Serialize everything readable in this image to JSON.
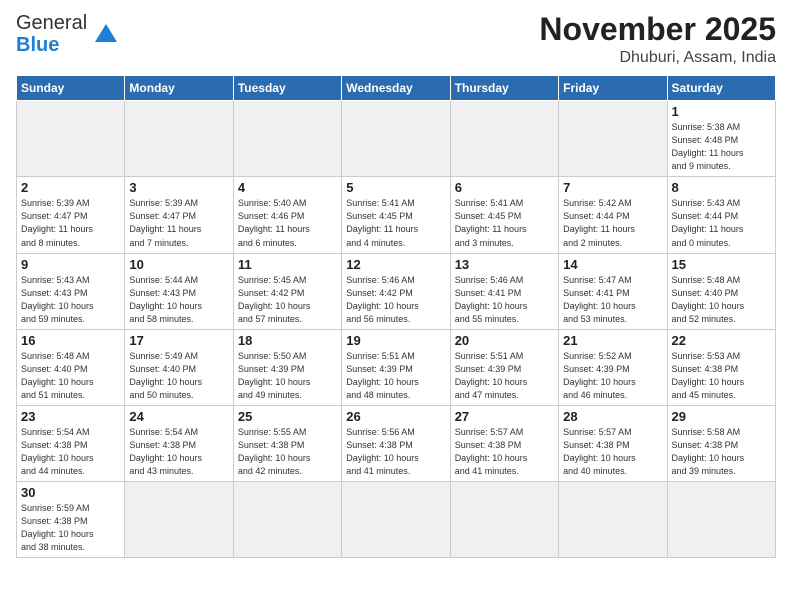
{
  "logo": {
    "general": "General",
    "blue": "Blue"
  },
  "header": {
    "month": "November 2025",
    "location": "Dhuburi, Assam, India"
  },
  "weekdays": [
    "Sunday",
    "Monday",
    "Tuesday",
    "Wednesday",
    "Thursday",
    "Friday",
    "Saturday"
  ],
  "weeks": [
    [
      {
        "day": "",
        "info": ""
      },
      {
        "day": "",
        "info": ""
      },
      {
        "day": "",
        "info": ""
      },
      {
        "day": "",
        "info": ""
      },
      {
        "day": "",
        "info": ""
      },
      {
        "day": "",
        "info": ""
      },
      {
        "day": "1",
        "info": "Sunrise: 5:38 AM\nSunset: 4:48 PM\nDaylight: 11 hours\nand 9 minutes."
      }
    ],
    [
      {
        "day": "2",
        "info": "Sunrise: 5:39 AM\nSunset: 4:47 PM\nDaylight: 11 hours\nand 8 minutes."
      },
      {
        "day": "3",
        "info": "Sunrise: 5:39 AM\nSunset: 4:47 PM\nDaylight: 11 hours\nand 7 minutes."
      },
      {
        "day": "4",
        "info": "Sunrise: 5:40 AM\nSunset: 4:46 PM\nDaylight: 11 hours\nand 6 minutes."
      },
      {
        "day": "5",
        "info": "Sunrise: 5:41 AM\nSunset: 4:45 PM\nDaylight: 11 hours\nand 4 minutes."
      },
      {
        "day": "6",
        "info": "Sunrise: 5:41 AM\nSunset: 4:45 PM\nDaylight: 11 hours\nand 3 minutes."
      },
      {
        "day": "7",
        "info": "Sunrise: 5:42 AM\nSunset: 4:44 PM\nDaylight: 11 hours\nand 2 minutes."
      },
      {
        "day": "8",
        "info": "Sunrise: 5:43 AM\nSunset: 4:44 PM\nDaylight: 11 hours\nand 0 minutes."
      }
    ],
    [
      {
        "day": "9",
        "info": "Sunrise: 5:43 AM\nSunset: 4:43 PM\nDaylight: 10 hours\nand 59 minutes."
      },
      {
        "day": "10",
        "info": "Sunrise: 5:44 AM\nSunset: 4:43 PM\nDaylight: 10 hours\nand 58 minutes."
      },
      {
        "day": "11",
        "info": "Sunrise: 5:45 AM\nSunset: 4:42 PM\nDaylight: 10 hours\nand 57 minutes."
      },
      {
        "day": "12",
        "info": "Sunrise: 5:46 AM\nSunset: 4:42 PM\nDaylight: 10 hours\nand 56 minutes."
      },
      {
        "day": "13",
        "info": "Sunrise: 5:46 AM\nSunset: 4:41 PM\nDaylight: 10 hours\nand 55 minutes."
      },
      {
        "day": "14",
        "info": "Sunrise: 5:47 AM\nSunset: 4:41 PM\nDaylight: 10 hours\nand 53 minutes."
      },
      {
        "day": "15",
        "info": "Sunrise: 5:48 AM\nSunset: 4:40 PM\nDaylight: 10 hours\nand 52 minutes."
      }
    ],
    [
      {
        "day": "16",
        "info": "Sunrise: 5:48 AM\nSunset: 4:40 PM\nDaylight: 10 hours\nand 51 minutes."
      },
      {
        "day": "17",
        "info": "Sunrise: 5:49 AM\nSunset: 4:40 PM\nDaylight: 10 hours\nand 50 minutes."
      },
      {
        "day": "18",
        "info": "Sunrise: 5:50 AM\nSunset: 4:39 PM\nDaylight: 10 hours\nand 49 minutes."
      },
      {
        "day": "19",
        "info": "Sunrise: 5:51 AM\nSunset: 4:39 PM\nDaylight: 10 hours\nand 48 minutes."
      },
      {
        "day": "20",
        "info": "Sunrise: 5:51 AM\nSunset: 4:39 PM\nDaylight: 10 hours\nand 47 minutes."
      },
      {
        "day": "21",
        "info": "Sunrise: 5:52 AM\nSunset: 4:39 PM\nDaylight: 10 hours\nand 46 minutes."
      },
      {
        "day": "22",
        "info": "Sunrise: 5:53 AM\nSunset: 4:38 PM\nDaylight: 10 hours\nand 45 minutes."
      }
    ],
    [
      {
        "day": "23",
        "info": "Sunrise: 5:54 AM\nSunset: 4:38 PM\nDaylight: 10 hours\nand 44 minutes."
      },
      {
        "day": "24",
        "info": "Sunrise: 5:54 AM\nSunset: 4:38 PM\nDaylight: 10 hours\nand 43 minutes."
      },
      {
        "day": "25",
        "info": "Sunrise: 5:55 AM\nSunset: 4:38 PM\nDaylight: 10 hours\nand 42 minutes."
      },
      {
        "day": "26",
        "info": "Sunrise: 5:56 AM\nSunset: 4:38 PM\nDaylight: 10 hours\nand 41 minutes."
      },
      {
        "day": "27",
        "info": "Sunrise: 5:57 AM\nSunset: 4:38 PM\nDaylight: 10 hours\nand 41 minutes."
      },
      {
        "day": "28",
        "info": "Sunrise: 5:57 AM\nSunset: 4:38 PM\nDaylight: 10 hours\nand 40 minutes."
      },
      {
        "day": "29",
        "info": "Sunrise: 5:58 AM\nSunset: 4:38 PM\nDaylight: 10 hours\nand 39 minutes."
      }
    ],
    [
      {
        "day": "30",
        "info": "Sunrise: 5:59 AM\nSunset: 4:38 PM\nDaylight: 10 hours\nand 38 minutes."
      },
      {
        "day": "",
        "info": ""
      },
      {
        "day": "",
        "info": ""
      },
      {
        "day": "",
        "info": ""
      },
      {
        "day": "",
        "info": ""
      },
      {
        "day": "",
        "info": ""
      },
      {
        "day": "",
        "info": ""
      }
    ]
  ]
}
